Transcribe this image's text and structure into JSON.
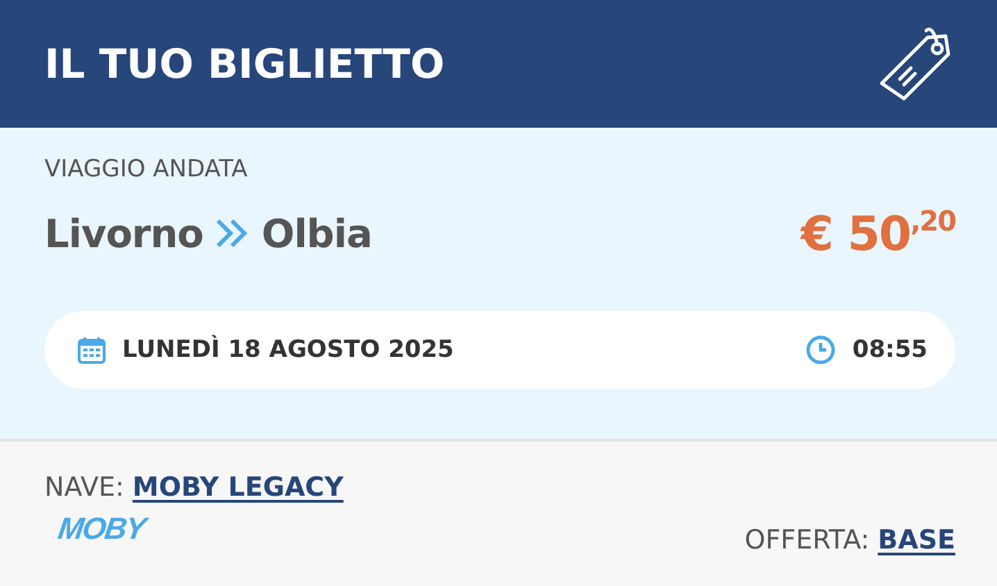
{
  "header": {
    "title": "IL TUO BIGLIETTO"
  },
  "trip": {
    "label": "VIAGGIO ANDATA",
    "from": "Livorno",
    "to": "Olbia",
    "price": "€ 50$^{,20}$"
  },
  "schedule": {
    "date": "LUNEDÌ 18 AGOSTO 2025",
    "time": "08:55"
  },
  "ship": {
    "label": "NAVE:",
    "name": "MOBY LEGACY",
    "logo_text": "MOBY"
  },
  "offer": {
    "label": "OFFERTA:",
    "name": "BASE"
  }
}
